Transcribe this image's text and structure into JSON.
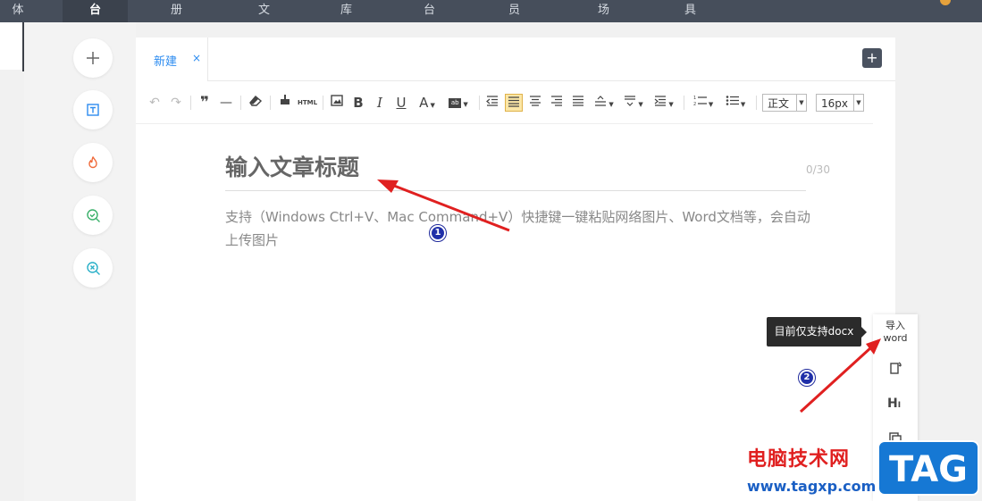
{
  "topnav": [
    "体",
    "台",
    "册",
    "文",
    "库",
    "台",
    "员",
    "场",
    "具"
  ],
  "tab": {
    "label": "新建",
    "close": "×"
  },
  "add_tab": "+",
  "toolbar": {
    "style_select": "正文",
    "size_select": "16px",
    "html_label": "HTML"
  },
  "editor": {
    "title_placeholder": "输入文章标题",
    "counter": "0/30",
    "body_placeholder": "支持（Windows Ctrl+V、Mac Command+V）快捷键一键粘贴网络图片、Word文档等，会自动上传图片"
  },
  "side": {
    "import_word": "导入\nword"
  },
  "tooltip": "目前仅支持docx",
  "annotations": {
    "one": "1",
    "two": "2"
  },
  "watermark": {
    "site": "电脑技术网",
    "url": "www.tagxp.com",
    "tag": "TAG"
  },
  "colors": {
    "accent": "#2d8cf0",
    "nav": "#464e5b",
    "arrow": "#e02020"
  }
}
